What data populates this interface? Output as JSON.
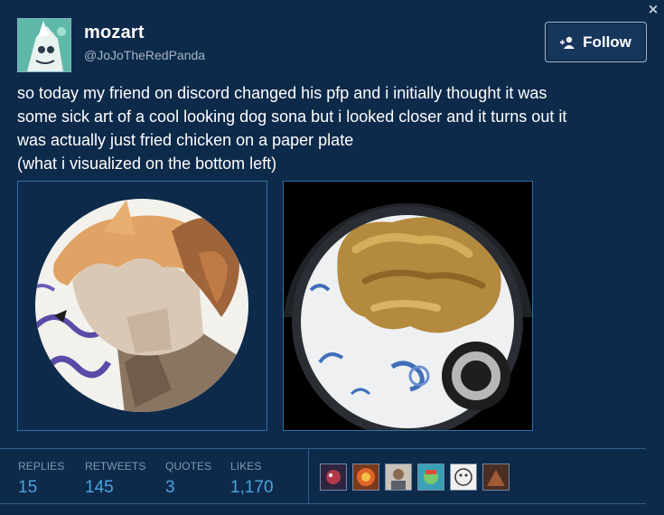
{
  "window": {
    "close_symbol": "×"
  },
  "author": {
    "display_name": "mozart",
    "handle": "@JoJoTheRedPanda",
    "avatar_icon": "avatar-character-icon"
  },
  "follow_button": {
    "label": "Follow",
    "icon": "add-user-icon"
  },
  "tweet": {
    "lines": [
      "so today my friend on discord changed his pfp and i initially thought it was",
      "some sick art of a cool looking dog sona but i looked closer and it turns out it",
      "was actually just fried chicken on a paper plate",
      "(what i visualized on the bottom left)"
    ]
  },
  "media": [
    {
      "name": "drawn-dog-sona-image",
      "description_icon": "dog-character-art"
    },
    {
      "name": "fried-chicken-plate-photo",
      "description_icon": "fried-chicken-photo"
    }
  ],
  "stats": {
    "replies": {
      "label": "REPLIES",
      "value": "15"
    },
    "retweets": {
      "label": "RETWEETS",
      "value": "145"
    },
    "quotes": {
      "label": "QUOTES",
      "value": "3"
    },
    "likes": {
      "label": "LIKES",
      "value": "1,170"
    }
  },
  "colors": {
    "background": "#0e2a4a",
    "accent": "#4aa3df",
    "muted": "#7e98b2"
  },
  "liker_avatars": [
    "liker-avatar-1",
    "liker-avatar-2",
    "liker-avatar-3",
    "liker-avatar-4",
    "liker-avatar-5",
    "liker-avatar-6"
  ]
}
